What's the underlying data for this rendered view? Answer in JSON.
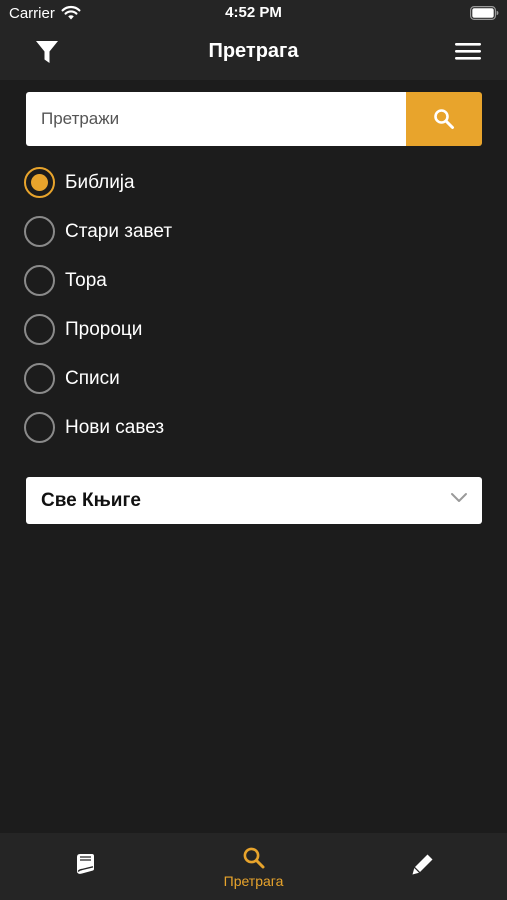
{
  "status_bar": {
    "carrier": "Carrier",
    "time": "4:52 PM"
  },
  "nav": {
    "title": "Претрага",
    "left_icon": "filter-icon",
    "right_icon": "hamburger-menu-icon"
  },
  "search": {
    "placeholder": "Претражи",
    "value": "",
    "button_icon": "search-icon"
  },
  "scopes": {
    "selected_index": 0,
    "items": [
      {
        "label": "Библија",
        "selected": true
      },
      {
        "label": "Стари завет",
        "selected": false
      },
      {
        "label": "Тора",
        "selected": false
      },
      {
        "label": "Пророци",
        "selected": false
      },
      {
        "label": "Списи",
        "selected": false
      },
      {
        "label": "Нови савез",
        "selected": false
      }
    ]
  },
  "book_select": {
    "value": "Све Књиге",
    "icon": "chevron-down-icon"
  },
  "tab_bar": {
    "tabs": [
      {
        "icon": "book-icon",
        "label": "",
        "active": false
      },
      {
        "icon": "search-icon",
        "label": "Претрага",
        "active": true
      },
      {
        "icon": "pencil-icon",
        "label": "",
        "active": false
      }
    ]
  },
  "colors": {
    "accent": "#e8a42c",
    "background": "#1c1c1c",
    "bar_background": "#252525",
    "radio_border": "#8a8a8a"
  }
}
